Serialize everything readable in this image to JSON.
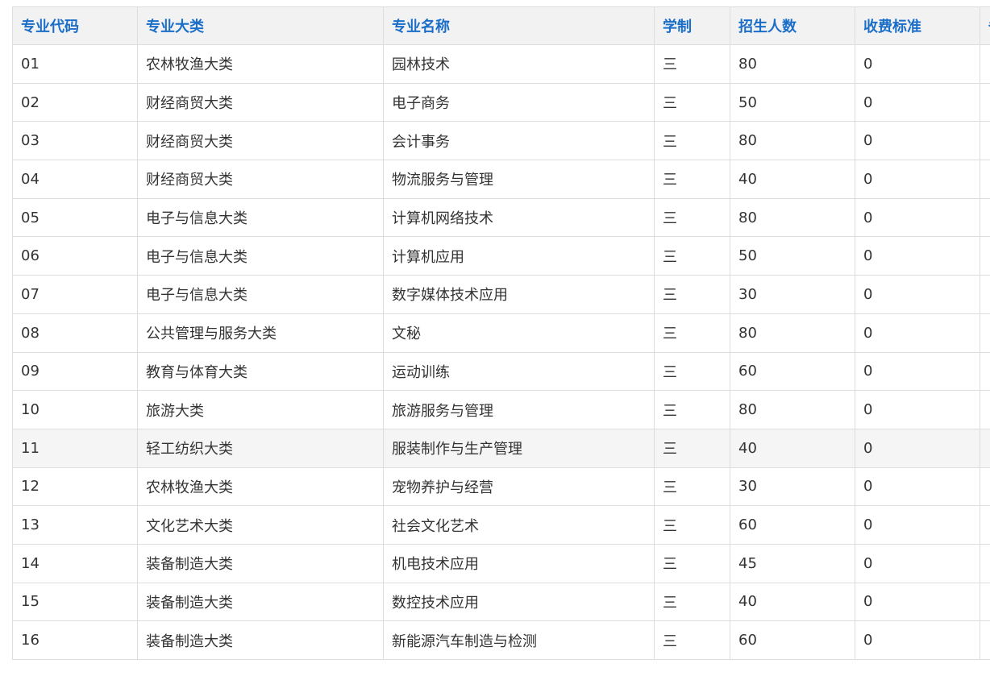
{
  "table": {
    "headers": [
      "专业代码",
      "专业大类",
      "专业名称",
      "学制",
      "招生人数",
      "收费标准",
      "备"
    ],
    "rows": [
      [
        "01",
        "农林牧渔大类",
        "园林技术",
        "三",
        "80",
        "0"
      ],
      [
        "02",
        "财经商贸大类",
        "电子商务",
        "三",
        "50",
        "0"
      ],
      [
        "03",
        "财经商贸大类",
        "会计事务",
        "三",
        "80",
        "0"
      ],
      [
        "04",
        "财经商贸大类",
        "物流服务与管理",
        "三",
        "40",
        "0"
      ],
      [
        "05",
        "电子与信息大类",
        "计算机网络技术",
        "三",
        "80",
        "0"
      ],
      [
        "06",
        "电子与信息大类",
        "计算机应用",
        "三",
        "50",
        "0"
      ],
      [
        "07",
        "电子与信息大类",
        "数字媒体技术应用",
        "三",
        "30",
        "0"
      ],
      [
        "08",
        "公共管理与服务大类",
        "文秘",
        "三",
        "80",
        "0"
      ],
      [
        "09",
        "教育与体育大类",
        "运动训练",
        "三",
        "60",
        "0"
      ],
      [
        "10",
        "旅游大类",
        "旅游服务与管理",
        "三",
        "80",
        "0"
      ],
      [
        "11",
        "轻工纺织大类",
        "服装制作与生产管理",
        "三",
        "40",
        "0"
      ],
      [
        "12",
        "农林牧渔大类",
        "宠物养护与经营",
        "三",
        "30",
        "0"
      ],
      [
        "13",
        "文化艺术大类",
        "社会文化艺术",
        "三",
        "60",
        "0"
      ],
      [
        "14",
        "装备制造大类",
        "机电技术应用",
        "三",
        "45",
        "0"
      ],
      [
        "15",
        "装备制造大类",
        "数控技术应用",
        "三",
        "40",
        "0"
      ],
      [
        "16",
        "装备制造大类",
        "新能源汽车制造与检测",
        "三",
        "60",
        "0"
      ]
    ],
    "hovered_row": 10
  },
  "colors": {
    "header_text": "#1a6ec8",
    "header_bg": "#f2f2f2",
    "border": "#dddddd",
    "body_text": "#333333",
    "hover_bg": "#f5f5f5"
  }
}
